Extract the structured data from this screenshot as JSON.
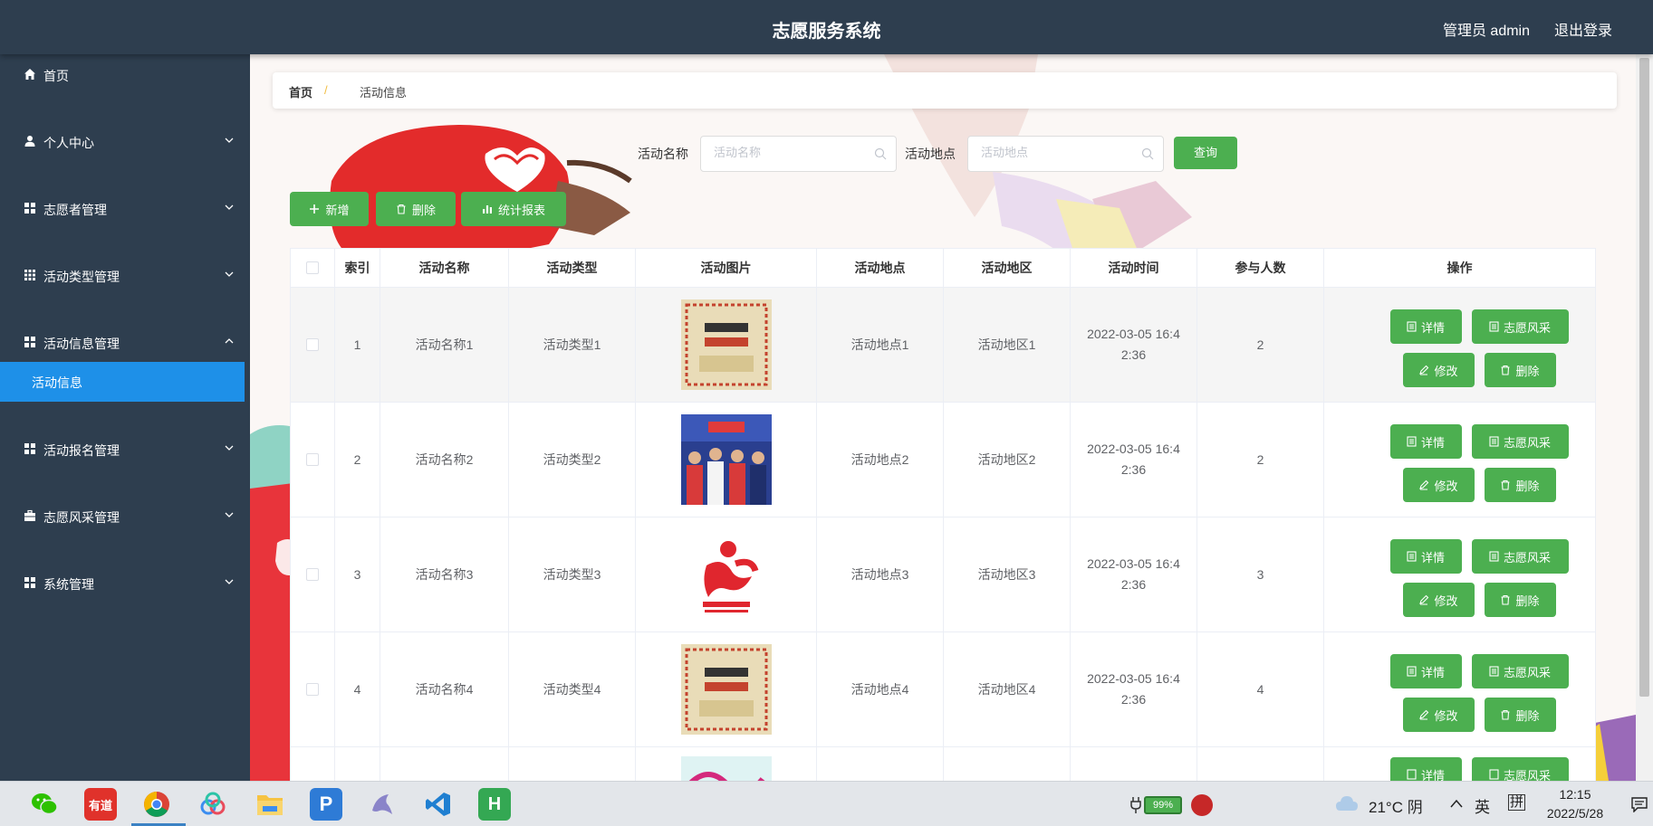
{
  "header": {
    "title": "志愿服务系统",
    "user": "管理员 admin",
    "logout": "退出登录"
  },
  "sidebar": {
    "items": [
      {
        "label": "首页",
        "icon": "home-icon"
      },
      {
        "label": "个人中心",
        "icon": "user-icon"
      },
      {
        "label": "志愿者管理",
        "icon": "grid-icon"
      },
      {
        "label": "活动类型管理",
        "icon": "grid-dots-icon"
      },
      {
        "label": "活动信息管理",
        "icon": "grid-icon"
      },
      {
        "label": "活动报名管理",
        "icon": "grid-icon"
      },
      {
        "label": "志愿风采管理",
        "icon": "briefcase-icon"
      },
      {
        "label": "系统管理",
        "icon": "grid-icon"
      }
    ],
    "active_sub": "活动信息"
  },
  "breadcrumb": {
    "home": "首页",
    "separator": "/",
    "current": "活动信息"
  },
  "search": {
    "name_label": "活动名称",
    "name_placeholder": "活动名称",
    "location_label": "活动地点",
    "location_placeholder": "活动地点",
    "query_button": "查询"
  },
  "toolbar": {
    "add": "新增",
    "delete": "删除",
    "report": "统计报表"
  },
  "table": {
    "headers": [
      "",
      "索引",
      "活动名称",
      "活动类型",
      "活动图片",
      "活动地点",
      "活动地区",
      "活动时间",
      "参与人数",
      "操作"
    ],
    "rows": [
      {
        "index": "1",
        "name": "活动名称1",
        "type": "活动类型1",
        "image": "poster-image",
        "location": "活动地点1",
        "region": "活动地区1",
        "time_a": "2022-03-05 16:4",
        "time_b": "2:36",
        "count": "2"
      },
      {
        "index": "2",
        "name": "活动名称2",
        "type": "活动类型2",
        "image": "group-photo-image",
        "location": "活动地点2",
        "region": "活动地区2",
        "time_a": "2022-03-05 16:4",
        "time_b": "2:36",
        "count": "2"
      },
      {
        "index": "3",
        "name": "活动名称3",
        "type": "活动类型3",
        "image": "yiwu-logo-image",
        "location": "活动地点3",
        "region": "活动地区3",
        "time_a": "2022-03-05 16:4",
        "time_b": "2:36",
        "count": "3"
      },
      {
        "index": "4",
        "name": "活动名称4",
        "type": "活动类型4",
        "image": "poster-image",
        "location": "活动地点4",
        "region": "活动地区4",
        "time_a": "2022-03-05 16:4",
        "time_b": "2:36",
        "count": "4"
      }
    ],
    "ops": {
      "detail": "详情",
      "style": "志愿风采",
      "edit": "修改",
      "delete": "删除"
    }
  },
  "taskbar": {
    "apps": [
      "wechat-icon",
      "youdao-icon",
      "chrome-icon",
      "baidu-netdisk-icon",
      "file-explorer-icon",
      "p-app-icon",
      "dolphin-icon",
      "vscode-icon",
      "hbuilder-icon"
    ],
    "youdao_label": "有道",
    "battery": "99%",
    "weather": "21°C 阴",
    "ime_lang": "英",
    "ime_mode": "拼",
    "time": "12:15",
    "date": "2022/5/28"
  },
  "colors": {
    "header_bg": "#2e3e4f",
    "active_menu": "#1e90e8",
    "green_button": "#4caf50"
  }
}
